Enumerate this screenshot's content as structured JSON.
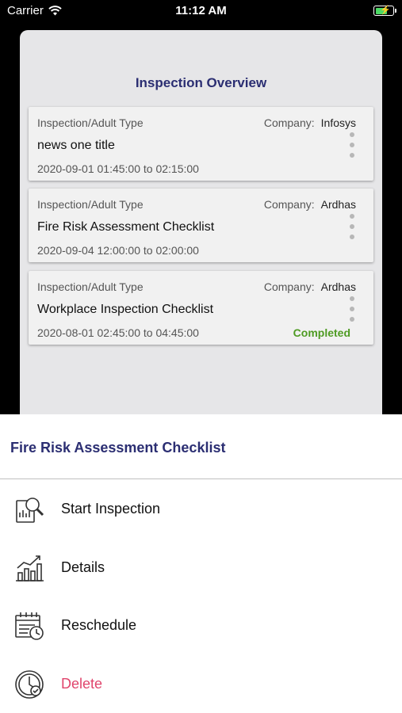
{
  "status_bar": {
    "carrier": "Carrier",
    "time": "11:12 AM"
  },
  "overview": {
    "title": "Inspection Overview",
    "company_label": "Company:",
    "cards": [
      {
        "type": "Inspection/Adult Type",
        "company": "Infosys",
        "title": "news one title",
        "dates": "2020-09-01 01:45:00 to 02:15:00",
        "status": ""
      },
      {
        "type": "Inspection/Adult Type",
        "company": "Ardhas",
        "title": "Fire Risk Assessment Checklist",
        "dates": "2020-09-04 12:00:00 to 02:00:00",
        "status": ""
      },
      {
        "type": "Inspection/Adult Type",
        "company": "Ardhas",
        "title": "Workplace Inspection Checklist",
        "dates": "2020-08-01 02:45:00 to 04:45:00",
        "status": "Completed"
      }
    ]
  },
  "action_sheet": {
    "title": "Fire Risk Assessment Checklist",
    "items": [
      {
        "label": "Start Inspection",
        "icon": "inspection-search-icon"
      },
      {
        "label": "Details",
        "icon": "chart-growth-icon"
      },
      {
        "label": "Reschedule",
        "icon": "calendar-clock-icon"
      },
      {
        "label": "Delete",
        "icon": "delete-clock-icon"
      }
    ]
  },
  "colors": {
    "accent": "#2b2e72",
    "completed": "#4e9b23",
    "danger": "#e0456c"
  }
}
